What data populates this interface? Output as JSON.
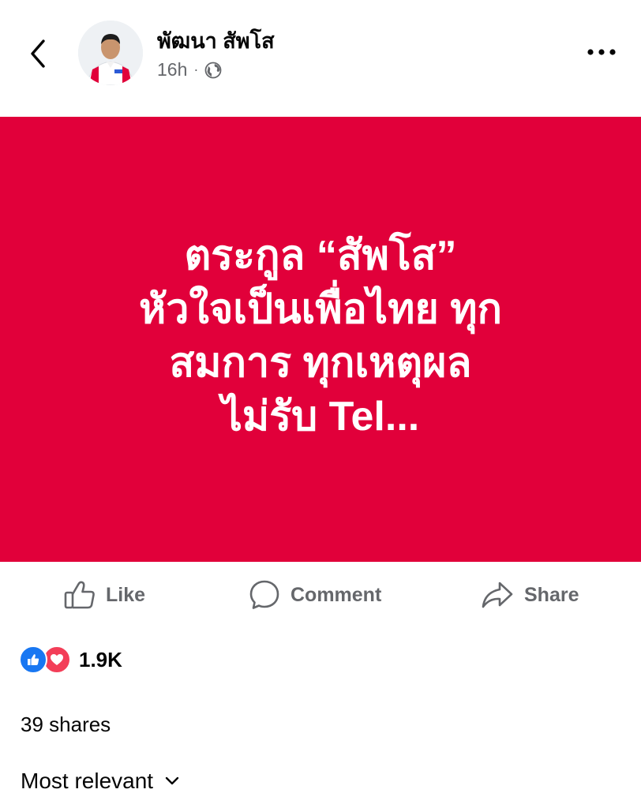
{
  "author": {
    "name": "พัฒนา สัพโส",
    "time": "16h",
    "separator": "·",
    "privacy_icon": "globe-icon"
  },
  "post": {
    "background": "#e1003a",
    "text_lines": [
      "ตระกูล “สัพโส”",
      "หัวใจเป็นเพื่อไทย ทุก",
      "สมการ ทุกเหตุผล",
      "ไม่รับ Tel..."
    ]
  },
  "actions": {
    "like_label": "Like",
    "comment_label": "Comment",
    "share_label": "Share"
  },
  "reactions": {
    "count": "1.9K",
    "types": [
      "like",
      "love"
    ],
    "like_color": "#1877f2",
    "love_color": "#f33e58"
  },
  "shares": {
    "label": "39 shares"
  },
  "comments": {
    "sort_label": "Most relevant",
    "sort_icon": "chevron-down-icon"
  },
  "colors": {
    "secondary_text": "#65676b",
    "primary_text": "#050505"
  }
}
